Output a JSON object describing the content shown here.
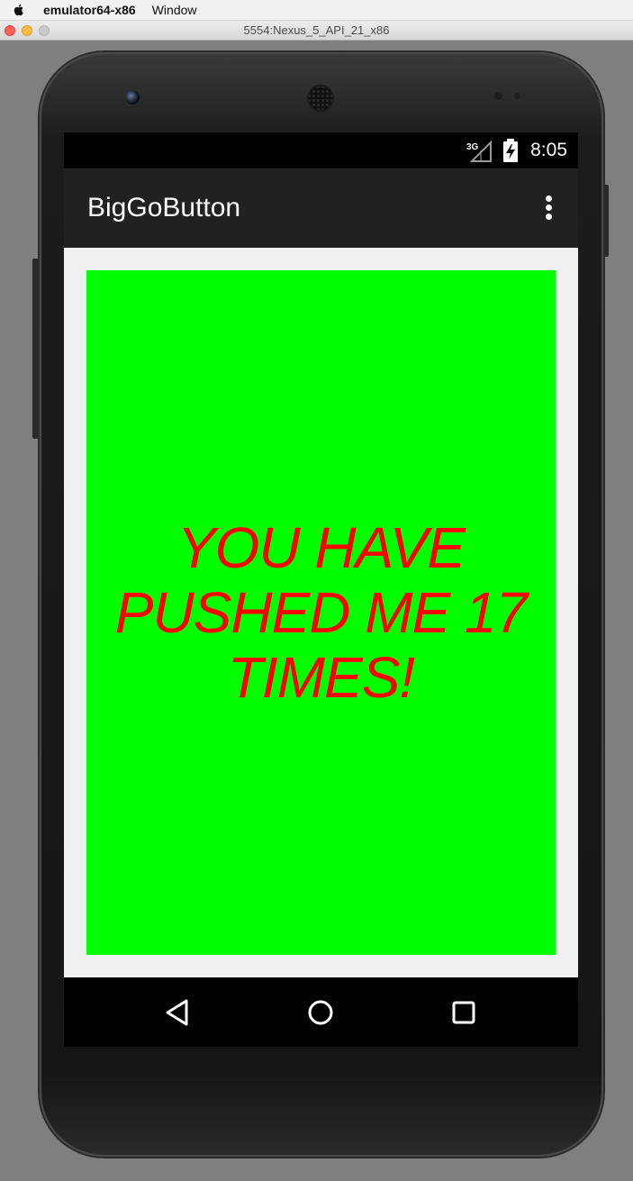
{
  "mac_menubar": {
    "app_name": "emulator64-x86",
    "menu_window": "Window"
  },
  "window": {
    "title": "5554:Nexus_5_API_21_x86"
  },
  "status_bar": {
    "network": "3G",
    "time": "8:05"
  },
  "app_bar": {
    "title": "BigGoButton",
    "overflow_icon": "more-vert-icon"
  },
  "main": {
    "button_label": "YOU HAVE PUSHED ME 17 TIMES!",
    "button_color": "#00ff00",
    "label_color": "#ff0000"
  },
  "nav_bar": {
    "back_icon": "back-icon",
    "home_icon": "home-icon",
    "recents_icon": "recents-icon"
  }
}
